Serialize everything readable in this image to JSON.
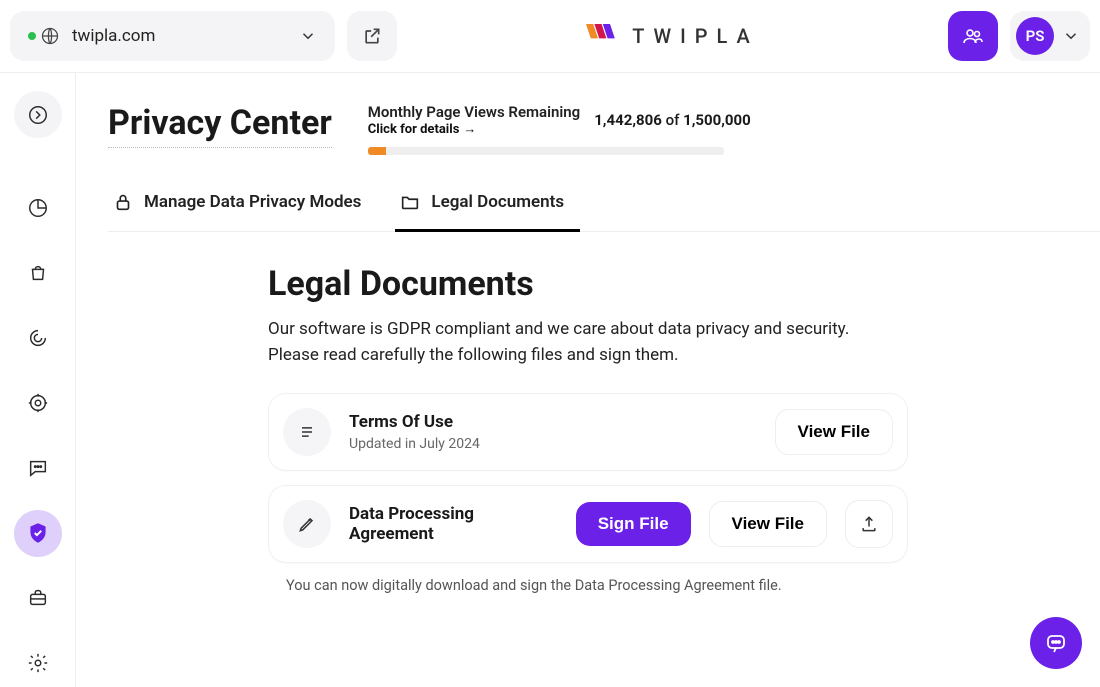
{
  "header": {
    "website": "twipla.com",
    "brand_text": "TWIPLA",
    "profile_initials": "PS"
  },
  "page": {
    "title": "Privacy Center",
    "quota": {
      "label": "Monthly Page Views Remaining",
      "details_cta": "Click for details",
      "used": "1,442,806",
      "separator": "of",
      "total": "1,500,000",
      "fill_percent": 5
    }
  },
  "tabs": [
    {
      "label": "Manage Data Privacy Modes",
      "active": false
    },
    {
      "label": "Legal Documents",
      "active": true
    }
  ],
  "legal": {
    "heading": "Legal Documents",
    "description": "Our software is GDPR compliant and we care about data privacy and security. Please read carefully the following files and sign them.",
    "docs": [
      {
        "title": "Terms Of Use",
        "subtitle": "Updated in July 2024",
        "actions": {
          "view": "View File"
        }
      },
      {
        "title": "Data Processing Agreement",
        "actions": {
          "sign": "Sign File",
          "view": "View File"
        }
      }
    ],
    "footnote": "You can now digitally download and sign the Data Processing Agreement file."
  },
  "colors": {
    "accent": "#6b21e8",
    "warning": "#f08a24"
  }
}
